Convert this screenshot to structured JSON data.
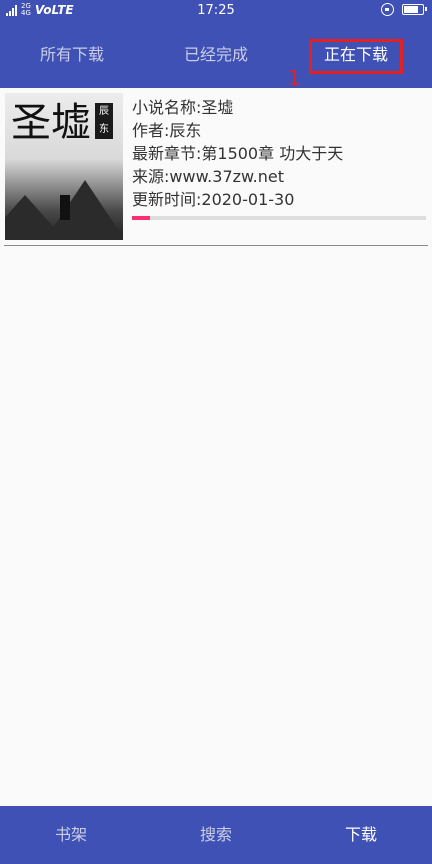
{
  "status_bar": {
    "network_top": "2G",
    "network_bottom": "4G",
    "carrier": "VoLTE",
    "time": "17:25",
    "icons": [
      "signal-icon",
      "lock-rotation-icon",
      "battery-icon"
    ]
  },
  "tabs": {
    "all": "所有下载",
    "completed": "已经完成",
    "downloading": "正在下载",
    "active": "downloading"
  },
  "annotation": {
    "marker": "1",
    "color": "#e22222"
  },
  "book": {
    "cover": {
      "title": "圣墟",
      "author_seal": "辰东"
    },
    "name_line": "小说名称:圣墟",
    "author_line": "作者:辰东",
    "latest_line": "最新章节:第1500章 功大于天",
    "source_line": "来源:www.37zw.net",
    "updated_line": "更新时间:2020-01-30",
    "progress_fraction": 0.06
  },
  "bottom_nav": {
    "shelf": "书架",
    "search": "搜索",
    "download": "下载",
    "active": "download"
  },
  "colors": {
    "primary": "#3f51b5",
    "progress": "#ff2d72",
    "background": "#fafafa"
  }
}
